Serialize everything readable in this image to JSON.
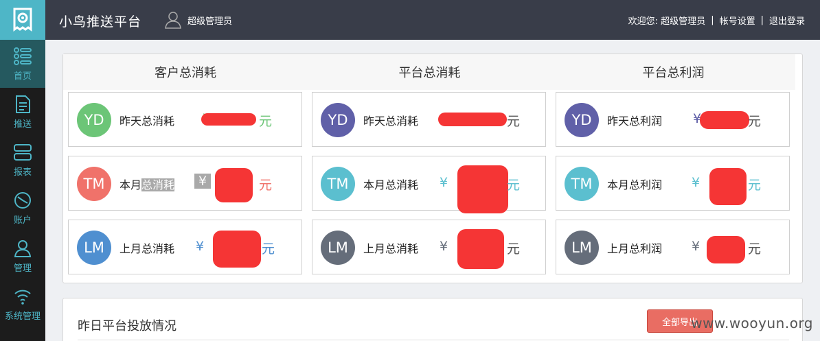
{
  "header": {
    "app_title": "小鸟推送平台",
    "user_name": "超级管理员",
    "welcome": "欢迎您: 超级管理员",
    "account_settings": "帐号设置",
    "logout": "退出登录",
    "separator": "|"
  },
  "sidebar": {
    "items": [
      {
        "label": "首页",
        "icon": "home-grid-icon",
        "active": true
      },
      {
        "label": "推送",
        "icon": "document-icon",
        "active": false
      },
      {
        "label": "报表",
        "icon": "report-icon",
        "active": false
      },
      {
        "label": "账户",
        "icon": "clock-icon",
        "active": false
      },
      {
        "label": "管理",
        "icon": "user-icon",
        "active": false
      },
      {
        "label": "系统管理",
        "icon": "wifi-icon",
        "active": false
      }
    ]
  },
  "stats": {
    "columns": [
      {
        "title": "客户总消耗"
      },
      {
        "title": "平台总消耗"
      },
      {
        "title": "平台总利润"
      }
    ],
    "cards": [
      [
        {
          "avatar": "YD",
          "label": "昨天总消耗",
          "currency": "¥",
          "unit": "元"
        },
        {
          "avatar": "TM",
          "label_plain": "本月",
          "label_highlight": "总消耗",
          "currency": "¥",
          "unit": "元"
        },
        {
          "avatar": "LM",
          "label": "上月总消耗",
          "currency": "¥",
          "unit": "元"
        }
      ],
      [
        {
          "avatar": "YD",
          "label": "昨天总消耗",
          "currency": "¥",
          "unit": "元"
        },
        {
          "avatar": "TM",
          "label": "本月总消耗",
          "currency": "¥",
          "unit": "元"
        },
        {
          "avatar": "LM",
          "label": "上月总消耗",
          "currency": "¥",
          "unit": "元"
        }
      ],
      [
        {
          "avatar": "YD",
          "label": "昨天总利润",
          "currency": "¥",
          "unit": "元"
        },
        {
          "avatar": "TM",
          "label": "本月总利润",
          "currency": "¥",
          "unit": "元"
        },
        {
          "avatar": "LM",
          "label": "上月总利润",
          "currency": "¥",
          "unit": "元"
        }
      ]
    ]
  },
  "colors": {
    "yd_avatar_col1": "#6cc577",
    "yd_avatar_col23": "#6060a8",
    "tm_avatar_col1": "#f0726a",
    "tm_avatar_col23": "#5bbfcf",
    "lm_avatar_col1": "#4f8fd0",
    "lm_avatar_col23": "#656d7a",
    "redaction": "#f53535"
  },
  "bottom_panel": {
    "title": "昨日平台投放情况",
    "export_button": "全部导出"
  },
  "watermark": "www.wooyun.org"
}
